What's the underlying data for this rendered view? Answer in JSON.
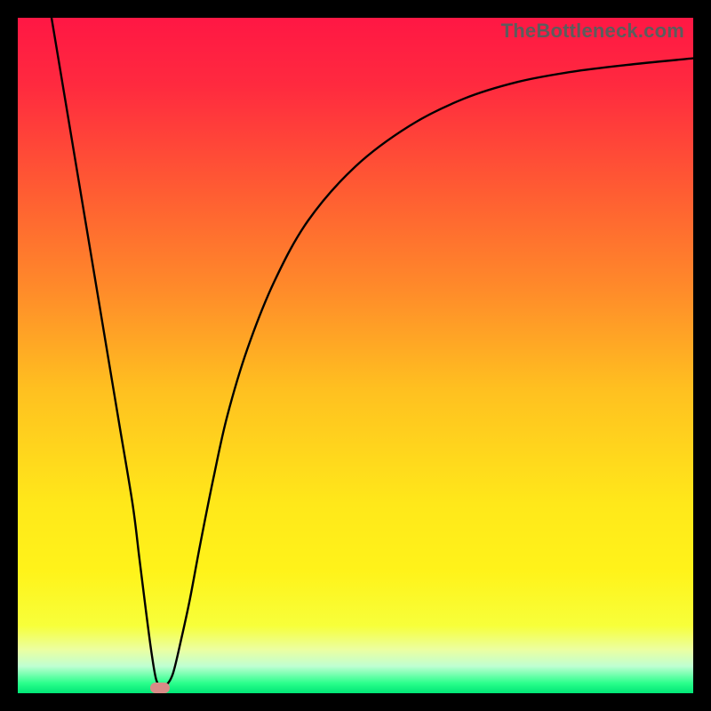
{
  "watermark": "TheBottleneck.com",
  "chart_data": {
    "type": "line",
    "title": "",
    "xlabel": "",
    "ylabel": "",
    "xlim": [
      0,
      100
    ],
    "ylim": [
      0,
      100
    ],
    "grid": false,
    "legend": false,
    "background_gradient": {
      "stops": [
        {
          "offset": 0.0,
          "color": "#ff1744"
        },
        {
          "offset": 0.1,
          "color": "#ff2a3f"
        },
        {
          "offset": 0.25,
          "color": "#ff5a33"
        },
        {
          "offset": 0.4,
          "color": "#ff8a2a"
        },
        {
          "offset": 0.55,
          "color": "#ffc020"
        },
        {
          "offset": 0.72,
          "color": "#ffe81a"
        },
        {
          "offset": 0.82,
          "color": "#fff31a"
        },
        {
          "offset": 0.9,
          "color": "#f7ff3a"
        },
        {
          "offset": 0.935,
          "color": "#ecffa0"
        },
        {
          "offset": 0.96,
          "color": "#bfffd2"
        },
        {
          "offset": 0.985,
          "color": "#2bff8c"
        },
        {
          "offset": 1.0,
          "color": "#00e676"
        }
      ]
    },
    "series": [
      {
        "name": "bottleneck-curve",
        "color": "#000000",
        "x": [
          5,
          7,
          9,
          11,
          13,
          15,
          17,
          18,
          19,
          19.8,
          20.5,
          21.3,
          22,
          23,
          24.2,
          25.5,
          27,
          29,
          31,
          34,
          38,
          43,
          50,
          58,
          66,
          74,
          82,
          90,
          100
        ],
        "y": [
          100,
          88,
          76,
          64,
          52,
          40,
          28,
          20,
          12,
          6,
          2,
          1,
          1.2,
          3,
          8,
          14,
          22,
          32,
          41,
          51,
          61,
          70,
          78,
          84,
          88,
          90.5,
          92,
          93,
          94
        ]
      }
    ],
    "marker": {
      "name": "optimal-point",
      "x": 21,
      "y": 0.8,
      "color": "#d98b87"
    },
    "notes": "V-shaped bottleneck curve over a vertical red→yellow→green gradient. Minimum (optimal point) near x≈21. Axes are unlabeled; values are proportional estimates read from the plot."
  }
}
